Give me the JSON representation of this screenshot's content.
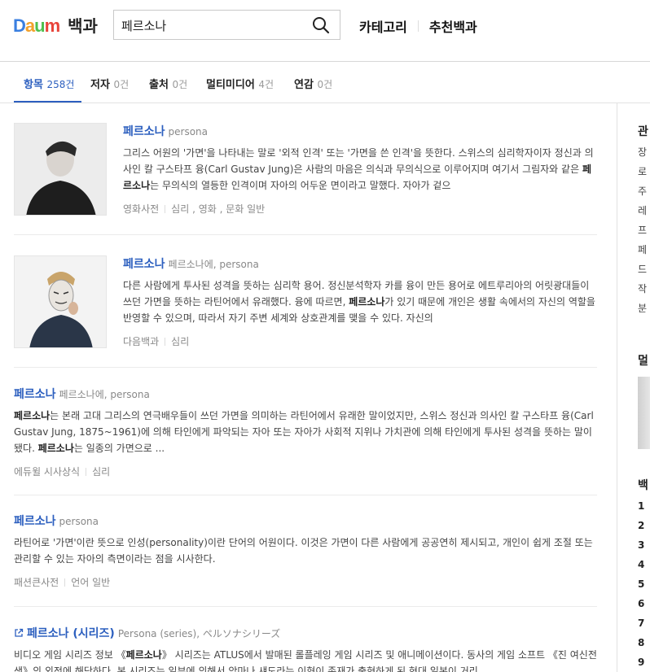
{
  "header": {
    "logo_text": "Daum",
    "logo_sub": "백과",
    "search_value": "페르소나",
    "nav": [
      "카테고리",
      "추천백과"
    ]
  },
  "tabs": [
    {
      "label": "항목",
      "count": "258건"
    },
    {
      "label": "저자",
      "count": "0건"
    },
    {
      "label": "출처",
      "count": "0건"
    },
    {
      "label": "멀티미디어",
      "count": "4건"
    },
    {
      "label": "연감",
      "count": "0건"
    }
  ],
  "results": [
    {
      "title": "페르소나",
      "subtitle": "persona",
      "desc_parts": [
        "그리스 어원의 '가면'을 나타내는 말로 '외적 인격' 또는 '가면을 쓴 인격'을 뜻한다. 스위스의 심리학자이자 정신과 의사인 칼 구스타프 융(Carl Gustav Jung)은 사람의 마음은 의식과 무의식으로 이루어지며 여기서 그림자와 같은 ",
        "페르소나",
        "는 무의식의 열등한 인격이며 자아의 어두운 면이라고 말했다. 자아가 겉으"
      ],
      "source": "영화사전",
      "category": "심리 , 영화 , 문화 일반"
    },
    {
      "title": "페르소나",
      "subtitle": "페르소나에, persona",
      "desc_parts": [
        "다른 사람에게 투사된 성격을 뜻하는 심리학 용어. 정신분석학자 카를 융이 만든 용어로 에트루리아의 어릿광대들이 쓰던 가면을 뜻하는 라틴어에서 유래했다. 융에 따르면, ",
        "페르소나",
        "가 있기 때문에 개인은 생활 속에서의 자신의 역할을 반영할 수 있으며, 따라서 자기 주변 세계와 상호관계를 맺을 수 있다. 자신의"
      ],
      "source": "다음백과",
      "category": "심리"
    },
    {
      "title": "페르소나",
      "subtitle": "페르소나에, persona",
      "desc_parts": [
        "",
        "페르소나",
        "는 본래 고대 그리스의 연극배우들이 쓰던 가면을 의미하는 라틴어에서 유래한 말이었지만, 스위스 정신과 의사인 칼 구스타프 융(Carl Gustav Jung, 1875~1961)에 의해 타인에게 파악되는 자아 또는 자아가 사회적 지위나 가치관에 의해 타인에게 투사된 성격을 뜻하는 말이 됐다. ",
        "페르소나",
        "는 일종의 가면으로 ..."
      ],
      "source": "에듀윌 시사상식",
      "category": "심리"
    },
    {
      "title": "페르소나",
      "subtitle": "persona",
      "desc_parts": [
        "라틴어로 '가면'이란 뜻으로 인성(personality)이란 단어의 어원이다. 이것은 가면이 다른 사람에게 공공연히 제시되고, 개인이 쉽게 조절 또는 관리할 수 있는 자아의 측면이라는 점을 시사한다."
      ],
      "source": "패션큰사전",
      "category": "언어 일반"
    },
    {
      "title": "페르소나 (시리즈)",
      "subtitle": "Persona (series), ペルソナシリーズ",
      "desc_parts": [
        "비디오 게임 시리즈 정보 《",
        "페르소나",
        "》 시리즈는 ATLUS에서 발매된 롤플레잉 게임 시리즈 및 애니메이션이다. 동사의 게임 소프트 《진 여신전생》의 외전에 해당하다. 본 시리즈는 일부에 의해서 악마나 섀도라는 이형이 존재가 출현하게 된 현대 일본이 거리"
      ]
    }
  ],
  "side": {
    "heading1": "관",
    "items": [
      "장",
      "로",
      "주",
      "레",
      "프",
      "페",
      "드",
      "작",
      "분"
    ],
    "heading2": "멀",
    "heading3": "백",
    "numbers": [
      "1",
      "2",
      "3",
      "4",
      "5",
      "6",
      "7",
      "8",
      "9"
    ]
  },
  "colors": {
    "accent": "#2c5fbf",
    "daum_d": "#3a7fe0",
    "daum_a": "#f2a12a",
    "daum_u": "#4fbf4f",
    "daum_m": "#e8443a"
  }
}
